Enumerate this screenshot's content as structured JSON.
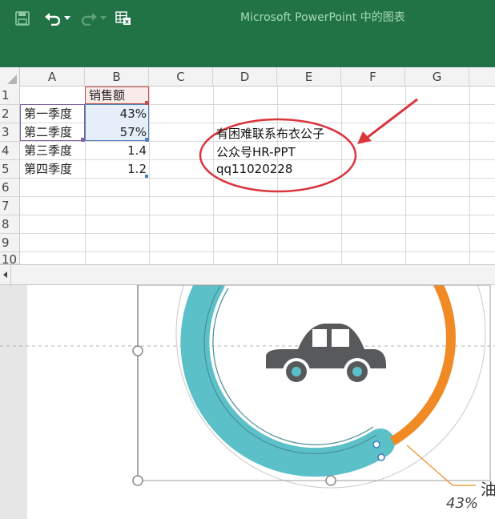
{
  "titlebar": {
    "title": "Microsoft PowerPoint 中的图表",
    "icons": [
      "save-icon",
      "undo-icon",
      "dropdown-icon",
      "redo-icon",
      "dropdown-icon",
      "edit-data-excel-icon"
    ],
    "color": "#217346"
  },
  "sheet": {
    "columns": [
      "A",
      "B",
      "C",
      "D",
      "E",
      "F",
      "G"
    ],
    "rows": [
      "1",
      "2",
      "3",
      "4",
      "5",
      "6",
      "7",
      "8",
      "9",
      "10"
    ],
    "b1_header": "销售额",
    "data": [
      {
        "label": "第一季度",
        "value": "43%"
      },
      {
        "label": "第二季度",
        "value": "57%"
      },
      {
        "label": "第三季度",
        "value": "1.4"
      },
      {
        "label": "第四季度",
        "value": "1.2"
      }
    ]
  },
  "annotation": {
    "line1": "有困难联系布衣公子",
    "line2": "公众号HR-PPT",
    "line3": "qq11020228",
    "color": "#d9363e"
  },
  "slide": {
    "percent_label": "43%",
    "series_label": "油",
    "teal": "#5bc0c8",
    "orange": "#f08a24",
    "car_color": "#58595b"
  }
}
